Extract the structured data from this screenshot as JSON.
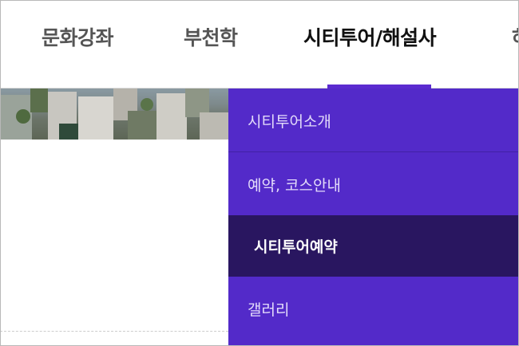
{
  "nav": {
    "items": [
      {
        "label": "문화강좌"
      },
      {
        "label": "부천학"
      },
      {
        "label": "시티투어/해설사",
        "active": true
      },
      {
        "label": "하"
      }
    ]
  },
  "submenu": {
    "items": [
      {
        "label": "시티투어소개"
      },
      {
        "label": "예약, 코스안내"
      },
      {
        "label": "시티투어예약",
        "active": true
      },
      {
        "label": "갤러리"
      }
    ]
  },
  "colors": {
    "accent": "#532ac9",
    "active_item_bg": "#291660",
    "active_nav_text": "#111111",
    "nav_text": "#555555"
  }
}
